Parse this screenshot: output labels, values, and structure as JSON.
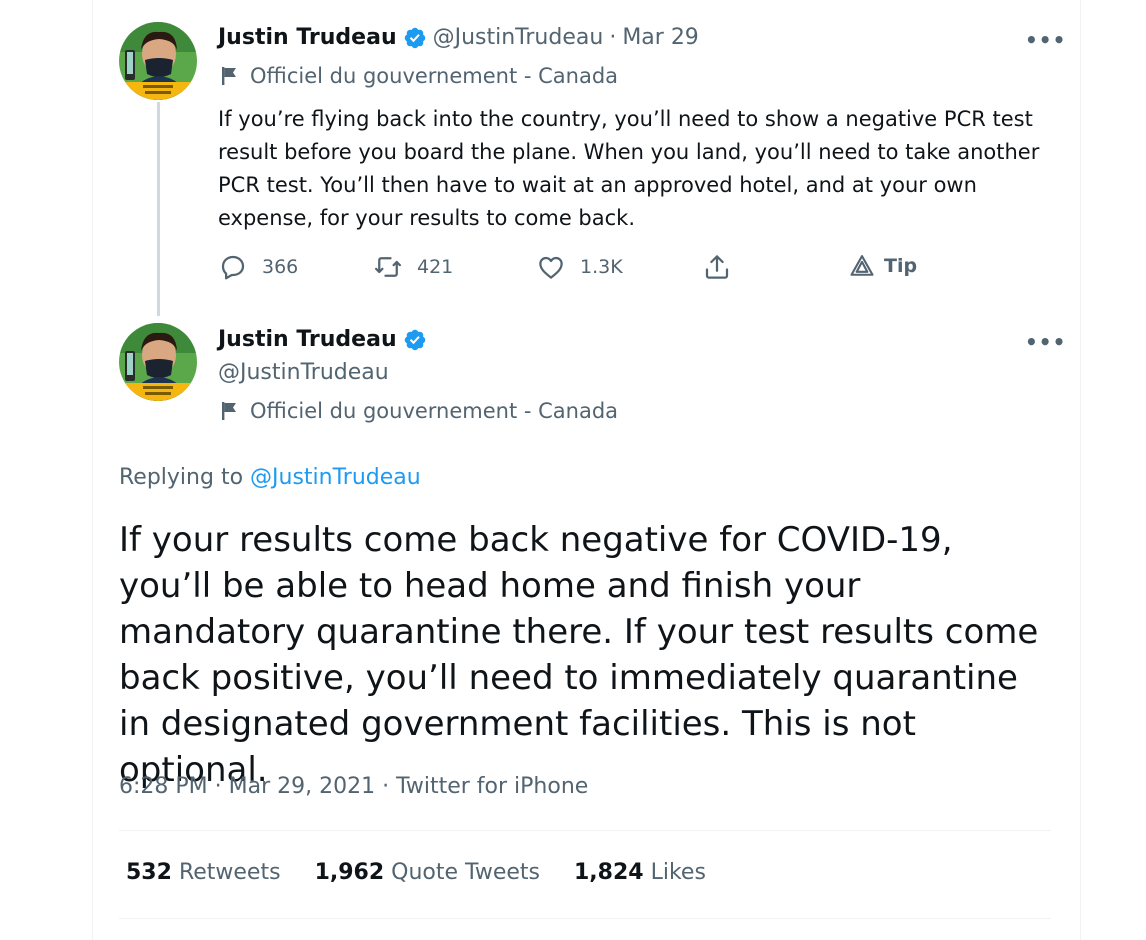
{
  "tweet1": {
    "author_name": "Justin Trudeau",
    "handle": "@JustinTrudeau",
    "separator": "·",
    "date": "Mar 29",
    "label": "Officiel du gouvernement - Canada",
    "text": "If you’re flying back into the country, you’ll need to show a negative PCR test result before you board the plane. When you land, you’ll need to take another PCR test. You’ll then have to wait at an approved hotel, and at your own expense, for your results to come back.",
    "actions": {
      "replies": "366",
      "retweets": "421",
      "likes": "1.3K",
      "tip": "Tip"
    }
  },
  "tweet2": {
    "author_name": "Justin Trudeau",
    "handle": "@JustinTrudeau",
    "label": "Officiel du gouvernement - Canada",
    "replying_prefix": "Replying to",
    "replying_handle": "@JustinTrudeau",
    "text": "If your results come back negative for COVID-19, you’ll be able to head home and finish your mandatory quarantine there. If your test results come back positive, you’ll need to immediately quarantine in designated government facilities. This is not optional.",
    "timestamp": "6:28 PM · Mar 29, 2021 · Twitter for iPhone",
    "stats": [
      {
        "count": "532",
        "label": "Retweets"
      },
      {
        "count": "1,962",
        "label": "Quote Tweets"
      },
      {
        "count": "1,824",
        "label": "Likes"
      }
    ]
  },
  "more_label": "•••",
  "colors": {
    "text": "#0f1419",
    "secondary": "#536471",
    "accent": "#1d9bf0",
    "avatar_bg": "#5aa84a",
    "avatar_band": "#f5b60f"
  },
  "icons": [
    "verified-badge-icon",
    "government-flag-icon",
    "reply-icon",
    "retweet-icon",
    "like-icon",
    "share-icon",
    "tip-icon",
    "more-icon"
  ]
}
